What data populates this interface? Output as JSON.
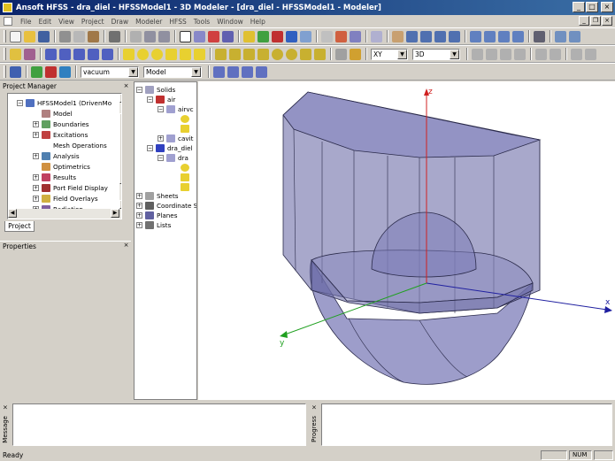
{
  "window": {
    "title": "Ansoft HFSS - dra_diel - HFSSModel1 - 3D Modeler - [dra_diel - HFSSModel1 - Modeler]"
  },
  "menu": [
    "File",
    "Edit",
    "View",
    "Project",
    "Draw",
    "Modeler",
    "HFSS",
    "Tools",
    "Window",
    "Help"
  ],
  "toolbar": {
    "material_combo": "vacuum",
    "model_combo": "Model",
    "plane_combo": "XY",
    "dimension_combo": "3D"
  },
  "project_manager": {
    "title": "Project Manager",
    "root": "HFSSModel1 (DrivenMo",
    "items": [
      "Model",
      "Boundaries",
      "Excitations",
      "Mesh Operations",
      "Analysis",
      "Optimetrics",
      "Results",
      "Port Field Display",
      "Field Overlays",
      "Radiation"
    ],
    "tab": "Project"
  },
  "properties": {
    "title": "Properties"
  },
  "history_tree": {
    "solids": "Solids",
    "air": "air",
    "airvol": "airvc",
    "cavity": "cavit",
    "dra_diel": "dra_diel",
    "dra": "dra",
    "sheets": "Sheets",
    "coord_systems": "Coordinate S",
    "planes": "Planes",
    "lists": "Lists"
  },
  "viewport": {
    "axis_x": "x",
    "axis_y": "y",
    "axis_z": "z"
  },
  "bottom": {
    "message_label": "Message",
    "progress_label": "Progress"
  },
  "status": {
    "text": "Ready",
    "num": "NUM"
  },
  "colors": {
    "title_start": "#0a246a",
    "title_end": "#3a6ea5",
    "model_fill": "#6e6ea8",
    "model_edge": "#2a2a4a"
  }
}
